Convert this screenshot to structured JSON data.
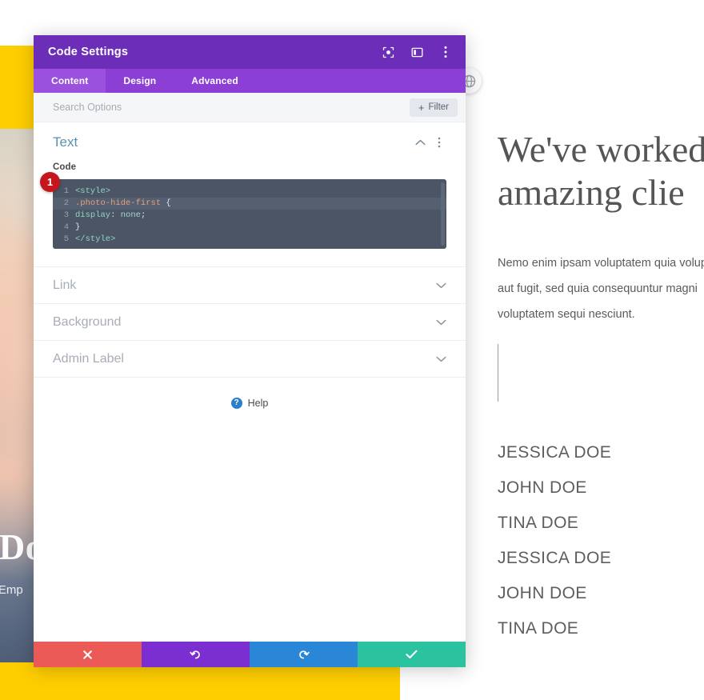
{
  "background_page": {
    "accent_yellow": "#ffce00",
    "photo_title": "a Doe",
    "photo_subtitle": "r of Emp"
  },
  "content": {
    "heading": "We've worked\namazing clie",
    "paragraph": "Nemo enim ipsam voluptatem quia voluptas\naut fugit, sed quia consequuntur magni\nvoluptatem sequi nesciunt.",
    "names": [
      "JESSICA DOE",
      "JOHN DOE",
      "TINA DOE",
      "JESSICA DOE",
      "JOHN DOE",
      "TINA DOE"
    ]
  },
  "modal": {
    "title": "Code Settings",
    "header_icons": [
      {
        "name": "focus-target-icon"
      },
      {
        "name": "layout-columns-icon"
      },
      {
        "name": "more-vertical-icon"
      }
    ],
    "tabs": [
      {
        "label": "Content",
        "active": true
      },
      {
        "label": "Design",
        "active": false
      },
      {
        "label": "Advanced",
        "active": false
      }
    ],
    "search": {
      "placeholder": "Search Options",
      "value": ""
    },
    "filter_button": {
      "plus": "+",
      "label": "Filter"
    },
    "sections": {
      "text": {
        "title": "Text",
        "expanded": true,
        "field_label": "Code",
        "step_badge": "1",
        "code_lines": [
          {
            "num": "1",
            "highlighted": false,
            "tokens": [
              {
                "cls": "ctok-tag",
                "t": "<style>"
              }
            ]
          },
          {
            "num": "2",
            "highlighted": true,
            "tokens": [
              {
                "cls": "ctok-sel",
                "t": ".photo-hide-first"
              },
              {
                "cls": "ctok-punc",
                "t": " {"
              }
            ]
          },
          {
            "num": "3",
            "highlighted": false,
            "tokens": [
              {
                "cls": "ctok-prop",
                "t": "display"
              },
              {
                "cls": "ctok-punc",
                "t": ": "
              },
              {
                "cls": "ctok-val",
                "t": "none"
              },
              {
                "cls": "ctok-punc",
                "t": ";"
              }
            ]
          },
          {
            "num": "4",
            "highlighted": false,
            "tokens": [
              {
                "cls": "ctok-punc",
                "t": "}"
              }
            ]
          },
          {
            "num": "5",
            "highlighted": false,
            "tokens": [
              {
                "cls": "ctok-tag",
                "t": "</style>"
              }
            ]
          }
        ]
      },
      "collapsed": [
        {
          "title": "Link"
        },
        {
          "title": "Background"
        },
        {
          "title": "Admin Label"
        }
      ]
    },
    "help": {
      "icon_glyph": "?",
      "label": "Help"
    },
    "footer_buttons": [
      {
        "name": "cancel-button",
        "icon": "close-icon",
        "color": "#eb5a56"
      },
      {
        "name": "undo-button",
        "icon": "undo-icon",
        "color": "#7c2fd0"
      },
      {
        "name": "redo-button",
        "icon": "redo-icon",
        "color": "#2a86d6"
      },
      {
        "name": "save-button",
        "icon": "check-icon",
        "color": "#2bc2a0"
      }
    ],
    "colors": {
      "header_purple": "#6c2eb9",
      "tabbar_purple": "#8b3fd4",
      "tab_active_purple": "#9a52de",
      "code_bg": "#4b5565",
      "section_title_blue": "#5b92b4",
      "badge_red": "#c4161c"
    }
  }
}
